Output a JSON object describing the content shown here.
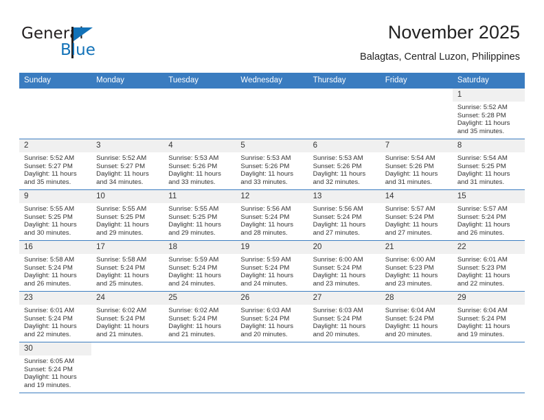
{
  "logo": {
    "text_top": "General",
    "text_bottom": "Blue",
    "accent_color": "#1272b8"
  },
  "header": {
    "title": "November 2025",
    "subtitle": "Balagtas, Central Luzon, Philippines",
    "header_bg_color": "#3a7cc0"
  },
  "weekdays": [
    "Sunday",
    "Monday",
    "Tuesday",
    "Wednesday",
    "Thursday",
    "Friday",
    "Saturday"
  ],
  "weeks": [
    [
      {
        "day": "",
        "blank": true
      },
      {
        "day": "",
        "blank": true
      },
      {
        "day": "",
        "blank": true
      },
      {
        "day": "",
        "blank": true
      },
      {
        "day": "",
        "blank": true
      },
      {
        "day": "",
        "blank": true
      },
      {
        "day": "1",
        "sunrise": "Sunrise: 5:52 AM",
        "sunset": "Sunset: 5:28 PM",
        "daylight": "Daylight: 11 hours and 35 minutes."
      }
    ],
    [
      {
        "day": "2",
        "sunrise": "Sunrise: 5:52 AM",
        "sunset": "Sunset: 5:27 PM",
        "daylight": "Daylight: 11 hours and 35 minutes."
      },
      {
        "day": "3",
        "sunrise": "Sunrise: 5:52 AM",
        "sunset": "Sunset: 5:27 PM",
        "daylight": "Daylight: 11 hours and 34 minutes."
      },
      {
        "day": "4",
        "sunrise": "Sunrise: 5:53 AM",
        "sunset": "Sunset: 5:26 PM",
        "daylight": "Daylight: 11 hours and 33 minutes."
      },
      {
        "day": "5",
        "sunrise": "Sunrise: 5:53 AM",
        "sunset": "Sunset: 5:26 PM",
        "daylight": "Daylight: 11 hours and 33 minutes."
      },
      {
        "day": "6",
        "sunrise": "Sunrise: 5:53 AM",
        "sunset": "Sunset: 5:26 PM",
        "daylight": "Daylight: 11 hours and 32 minutes."
      },
      {
        "day": "7",
        "sunrise": "Sunrise: 5:54 AM",
        "sunset": "Sunset: 5:26 PM",
        "daylight": "Daylight: 11 hours and 31 minutes."
      },
      {
        "day": "8",
        "sunrise": "Sunrise: 5:54 AM",
        "sunset": "Sunset: 5:25 PM",
        "daylight": "Daylight: 11 hours and 31 minutes."
      }
    ],
    [
      {
        "day": "9",
        "sunrise": "Sunrise: 5:55 AM",
        "sunset": "Sunset: 5:25 PM",
        "daylight": "Daylight: 11 hours and 30 minutes."
      },
      {
        "day": "10",
        "sunrise": "Sunrise: 5:55 AM",
        "sunset": "Sunset: 5:25 PM",
        "daylight": "Daylight: 11 hours and 29 minutes."
      },
      {
        "day": "11",
        "sunrise": "Sunrise: 5:55 AM",
        "sunset": "Sunset: 5:25 PM",
        "daylight": "Daylight: 11 hours and 29 minutes."
      },
      {
        "day": "12",
        "sunrise": "Sunrise: 5:56 AM",
        "sunset": "Sunset: 5:24 PM",
        "daylight": "Daylight: 11 hours and 28 minutes."
      },
      {
        "day": "13",
        "sunrise": "Sunrise: 5:56 AM",
        "sunset": "Sunset: 5:24 PM",
        "daylight": "Daylight: 11 hours and 27 minutes."
      },
      {
        "day": "14",
        "sunrise": "Sunrise: 5:57 AM",
        "sunset": "Sunset: 5:24 PM",
        "daylight": "Daylight: 11 hours and 27 minutes."
      },
      {
        "day": "15",
        "sunrise": "Sunrise: 5:57 AM",
        "sunset": "Sunset: 5:24 PM",
        "daylight": "Daylight: 11 hours and 26 minutes."
      }
    ],
    [
      {
        "day": "16",
        "sunrise": "Sunrise: 5:58 AM",
        "sunset": "Sunset: 5:24 PM",
        "daylight": "Daylight: 11 hours and 26 minutes."
      },
      {
        "day": "17",
        "sunrise": "Sunrise: 5:58 AM",
        "sunset": "Sunset: 5:24 PM",
        "daylight": "Daylight: 11 hours and 25 minutes."
      },
      {
        "day": "18",
        "sunrise": "Sunrise: 5:59 AM",
        "sunset": "Sunset: 5:24 PM",
        "daylight": "Daylight: 11 hours and 24 minutes."
      },
      {
        "day": "19",
        "sunrise": "Sunrise: 5:59 AM",
        "sunset": "Sunset: 5:24 PM",
        "daylight": "Daylight: 11 hours and 24 minutes."
      },
      {
        "day": "20",
        "sunrise": "Sunrise: 6:00 AM",
        "sunset": "Sunset: 5:24 PM",
        "daylight": "Daylight: 11 hours and 23 minutes."
      },
      {
        "day": "21",
        "sunrise": "Sunrise: 6:00 AM",
        "sunset": "Sunset: 5:23 PM",
        "daylight": "Daylight: 11 hours and 23 minutes."
      },
      {
        "day": "22",
        "sunrise": "Sunrise: 6:01 AM",
        "sunset": "Sunset: 5:23 PM",
        "daylight": "Daylight: 11 hours and 22 minutes."
      }
    ],
    [
      {
        "day": "23",
        "sunrise": "Sunrise: 6:01 AM",
        "sunset": "Sunset: 5:24 PM",
        "daylight": "Daylight: 11 hours and 22 minutes."
      },
      {
        "day": "24",
        "sunrise": "Sunrise: 6:02 AM",
        "sunset": "Sunset: 5:24 PM",
        "daylight": "Daylight: 11 hours and 21 minutes."
      },
      {
        "day": "25",
        "sunrise": "Sunrise: 6:02 AM",
        "sunset": "Sunset: 5:24 PM",
        "daylight": "Daylight: 11 hours and 21 minutes."
      },
      {
        "day": "26",
        "sunrise": "Sunrise: 6:03 AM",
        "sunset": "Sunset: 5:24 PM",
        "daylight": "Daylight: 11 hours and 20 minutes."
      },
      {
        "day": "27",
        "sunrise": "Sunrise: 6:03 AM",
        "sunset": "Sunset: 5:24 PM",
        "daylight": "Daylight: 11 hours and 20 minutes."
      },
      {
        "day": "28",
        "sunrise": "Sunrise: 6:04 AM",
        "sunset": "Sunset: 5:24 PM",
        "daylight": "Daylight: 11 hours and 20 minutes."
      },
      {
        "day": "29",
        "sunrise": "Sunrise: 6:04 AM",
        "sunset": "Sunset: 5:24 PM",
        "daylight": "Daylight: 11 hours and 19 minutes."
      }
    ],
    [
      {
        "day": "30",
        "sunrise": "Sunrise: 6:05 AM",
        "sunset": "Sunset: 5:24 PM",
        "daylight": "Daylight: 11 hours and 19 minutes."
      },
      {
        "day": "",
        "blank": true
      },
      {
        "day": "",
        "blank": true
      },
      {
        "day": "",
        "blank": true
      },
      {
        "day": "",
        "blank": true
      },
      {
        "day": "",
        "blank": true
      },
      {
        "day": "",
        "blank": true
      }
    ]
  ]
}
